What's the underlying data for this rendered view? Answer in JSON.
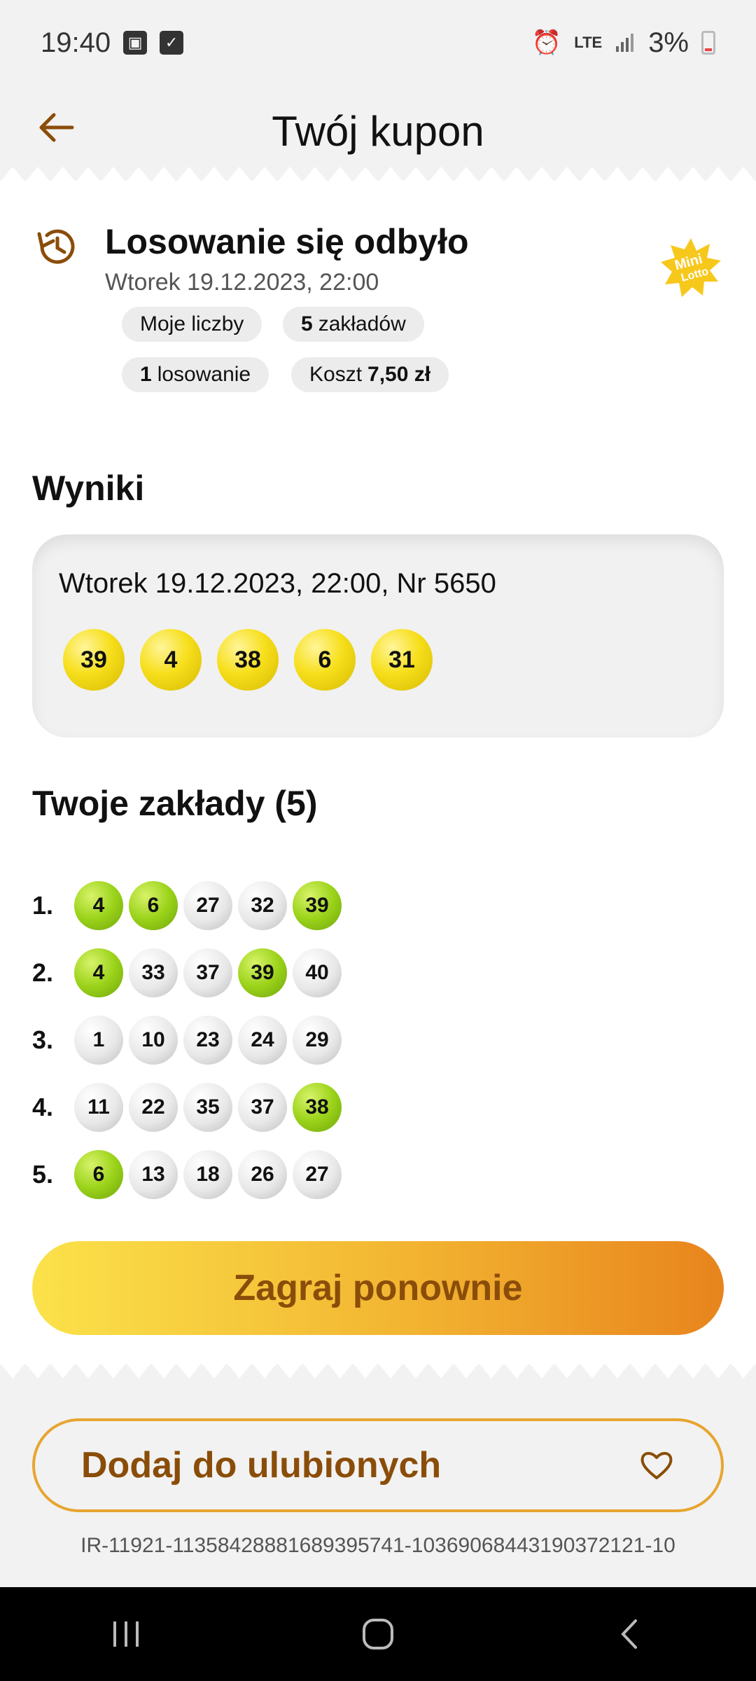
{
  "status_bar": {
    "time": "19:40",
    "network": "LTE",
    "battery": "3%"
  },
  "header": {
    "title": "Twój kupon"
  },
  "draw": {
    "status": "Losowanie się odbyło",
    "date": "Wtorek 19.12.2023, 22:00",
    "logo_text_top": "Mini",
    "logo_text_bottom": "Lotto",
    "chips": [
      {
        "bold": "",
        "text": "Moje liczby"
      },
      {
        "bold": "5",
        "text": "zakładów"
      },
      {
        "bold": "1",
        "text": "losowanie"
      },
      {
        "prefix": "Koszt",
        "bold": "7,50 zł"
      }
    ]
  },
  "results": {
    "title": "Wyniki",
    "date_line": "Wtorek 19.12.2023, 22:00, Nr 5650",
    "numbers": [
      "39",
      "4",
      "38",
      "6",
      "31"
    ]
  },
  "bets": {
    "title": "Twoje zakłady (5)",
    "rows": [
      {
        "index": "1.",
        "balls": [
          {
            "n": "4",
            "hit": true
          },
          {
            "n": "6",
            "hit": true
          },
          {
            "n": "27",
            "hit": false
          },
          {
            "n": "32",
            "hit": false
          },
          {
            "n": "39",
            "hit": true
          }
        ]
      },
      {
        "index": "2.",
        "balls": [
          {
            "n": "4",
            "hit": true
          },
          {
            "n": "33",
            "hit": false
          },
          {
            "n": "37",
            "hit": false
          },
          {
            "n": "39",
            "hit": true
          },
          {
            "n": "40",
            "hit": false
          }
        ]
      },
      {
        "index": "3.",
        "balls": [
          {
            "n": "1",
            "hit": false
          },
          {
            "n": "10",
            "hit": false
          },
          {
            "n": "23",
            "hit": false
          },
          {
            "n": "24",
            "hit": false
          },
          {
            "n": "29",
            "hit": false
          }
        ]
      },
      {
        "index": "4.",
        "balls": [
          {
            "n": "11",
            "hit": false
          },
          {
            "n": "22",
            "hit": false
          },
          {
            "n": "35",
            "hit": false
          },
          {
            "n": "37",
            "hit": false
          },
          {
            "n": "38",
            "hit": true
          }
        ]
      },
      {
        "index": "5.",
        "balls": [
          {
            "n": "6",
            "hit": true
          },
          {
            "n": "13",
            "hit": false
          },
          {
            "n": "18",
            "hit": false
          },
          {
            "n": "26",
            "hit": false
          },
          {
            "n": "27",
            "hit": false
          }
        ]
      }
    ]
  },
  "buttons": {
    "play_again": "Zagraj ponownie",
    "favorite": "Dodaj do ulubionych"
  },
  "coupon_id": "IR-11921-1135842888168939574​1-10369068443190372121-10",
  "colors": {
    "accent_dark": "#8a4d09",
    "accent": "#e7a52f",
    "ball_yellow": "#f7df1c",
    "ball_green": "#9bd31a"
  },
  "icons": [
    "back-arrow-icon",
    "history-icon",
    "mini-lotto-logo",
    "heart-icon",
    "nav-recents-icon",
    "nav-home-icon",
    "nav-back-icon"
  ]
}
